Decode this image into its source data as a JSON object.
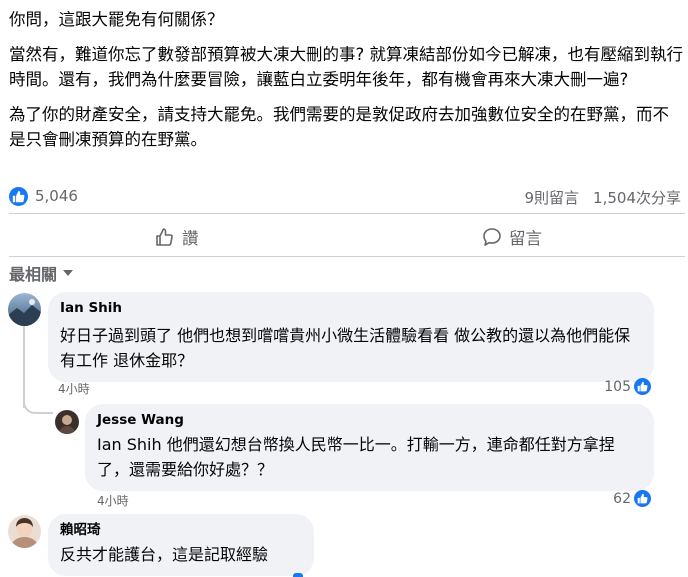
{
  "post": {
    "paragraphs": [
      "你問，這跟大罷免有何關係？",
      "當然有，難道你忘了數發部預算被大凍大刪的事? 就算凍結部份如今已解凍，也有壓縮到執行時間。還有，我們為什麼要冒險，讓藍白立委明年後年，都有機會再來大凍大刪一遍?",
      "為了你的財產安全，請支持大罷免。我們需要的是敦促政府去加強數位安全的在野黨，而不是只會刪凍預算的在野黨。"
    ]
  },
  "stats": {
    "reactions": "5,046",
    "comments": "9則留言",
    "shares": "1,504次分享"
  },
  "actions": {
    "like": "讚",
    "comment": "留言"
  },
  "sort": {
    "label": "最相關"
  },
  "comments": [
    {
      "author": "Ian Shih",
      "text": "好日子過到頭了 他們也想到嚐嚐貴州小微生活體驗看看 做公教的還以為他們能保有工作 退休金耶？",
      "time": "4小時",
      "likes": "105"
    },
    {
      "author": "Jesse Wang",
      "text": "Ian Shih 他們還幻想台幣換人民幣一比一。打輸一方，連命都任對方拿捏了，還需要給你好處？？",
      "time": "4小時",
      "likes": "62"
    },
    {
      "author": "賴昭琦",
      "text": "反共才能護台，這是記取經驗"
    }
  ],
  "colors": {
    "accent": "#1877f2",
    "bubble": "#f0f2f5",
    "muted": "#65676b"
  }
}
